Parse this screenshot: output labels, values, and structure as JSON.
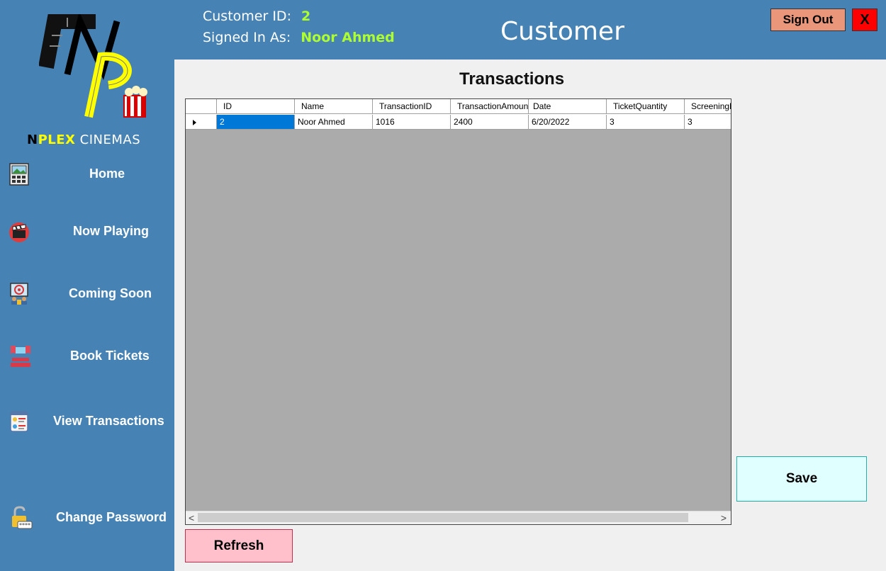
{
  "header": {
    "customer_id_label": "Customer ID:",
    "customer_id_value": "2",
    "signed_in_label": "Signed In As:",
    "signed_in_value": "Noor Ahmed",
    "title": "Customer",
    "sign_out_label": "Sign Out",
    "close_label": "X"
  },
  "brand": {
    "name_n": "N",
    "name_plex": "PLEX",
    "name_rest": " CINEMAS"
  },
  "sidebar": {
    "items": [
      {
        "label": "Home",
        "icon": "gallery-calendar-icon"
      },
      {
        "label": "Now Playing",
        "icon": "clapperboard-icon"
      },
      {
        "label": "Coming Soon",
        "icon": "audience-screen-icon"
      },
      {
        "label": "Book Tickets",
        "icon": "theater-seats-icon"
      },
      {
        "label": "View Transactions",
        "icon": "document-list-icon"
      },
      {
        "label": "Change Password",
        "icon": "padlock-password-icon"
      }
    ]
  },
  "main": {
    "title": "Transactions",
    "refresh_label": "Refresh",
    "save_label": "Save",
    "grid": {
      "columns": [
        "ID",
        "Name",
        "TransactionID",
        "TransactionAmount",
        "Date",
        "TicketQuantity",
        "ScreeningN"
      ],
      "rows": [
        [
          "2",
          "Noor Ahmed",
          "1016",
          "2400",
          "6/20/2022",
          "3",
          "3"
        ]
      ],
      "scroll_left": "<",
      "scroll_right": ">"
    }
  },
  "colors": {
    "sidebar_bg": "#4682b4",
    "accent_green": "#adff2f",
    "sign_out_bg": "#e9967a",
    "close_bg": "#ff0000",
    "refresh_bg": "#ffc0cb",
    "save_bg": "#e0ffff",
    "selected_cell": "#0078d7"
  }
}
